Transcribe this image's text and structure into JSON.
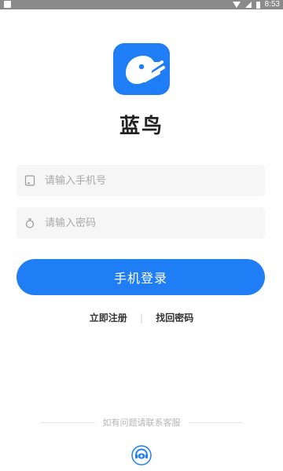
{
  "status_bar": {
    "time": "8:53",
    "icons": [
      "app-notification-icon",
      "wifi-icon",
      "signal-icon",
      "battery-icon"
    ]
  },
  "app": {
    "name": "蓝鸟",
    "logo_icon": "bluebird-logo",
    "brand_color": "#1f7ef5"
  },
  "form": {
    "phone_placeholder": "请输入手机号",
    "password_placeholder": "请输入密码",
    "phone_icon": "phone-icon",
    "password_icon": "lock-icon"
  },
  "login_button": "手机登录",
  "links": {
    "register": "立即注册",
    "forgot_password": "找回密码"
  },
  "support_text": "如有问题请联系客服",
  "support_icon": "customer-service-icon"
}
